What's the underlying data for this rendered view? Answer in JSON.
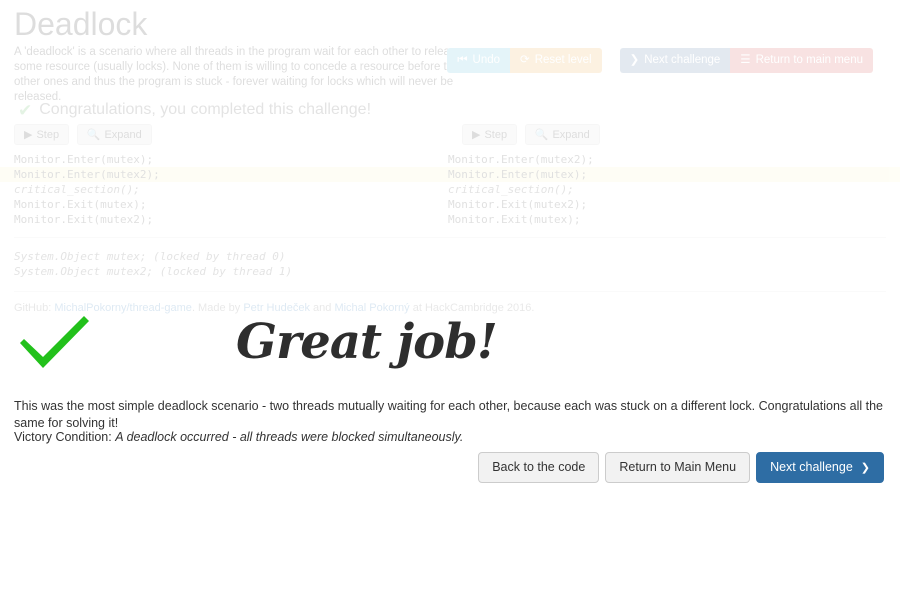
{
  "header": {
    "title": "Deadlock",
    "description": "A 'deadlock' is a scenario where all threads in the program wait for each other to release some resource (usually locks). None of them is willing to concede a resource before the other ones and thus the program is stuck - forever waiting for locks which will never be released."
  },
  "top_buttons": {
    "undo": "Undo",
    "reset": "Reset level",
    "next_challenge": "Next challenge",
    "return_menu": "Return to main menu",
    "undo_icon": "step-backward-icon",
    "reset_icon": "refresh-icon",
    "next_icon": "chevron-right-icon",
    "menu_icon": "hamburger-menu-icon"
  },
  "status": {
    "check_icon": "check-mark-icon",
    "message": "Congratulations, you completed this challenge!"
  },
  "thread_controls": {
    "step": "Step",
    "expand": "Expand",
    "step_icon": "play-icon",
    "expand_icon": "magnifier-icon"
  },
  "code": {
    "rows": [
      {
        "left": "Monitor.Enter(mutex);",
        "right": "Monitor.Enter(mutex2);",
        "highlight": false,
        "italic": false
      },
      {
        "left": "Monitor.Enter(mutex2);",
        "right": "Monitor.Enter(mutex);",
        "highlight": true,
        "italic": false
      },
      {
        "left": "critical_section();",
        "right": "critical_section();",
        "highlight": false,
        "italic": true
      },
      {
        "left": "Monitor.Exit(mutex);",
        "right": "Monitor.Exit(mutex2);",
        "highlight": false,
        "italic": false
      },
      {
        "left": "Monitor.Exit(mutex2);",
        "right": "Monitor.Exit(mutex);",
        "highlight": false,
        "italic": false
      }
    ]
  },
  "locks": {
    "lines": [
      "System.Object mutex; (locked by thread 0)",
      "System.Object mutex2; (locked by thread 1)"
    ]
  },
  "credits": {
    "github_label": "GitHub:",
    "repo": "MichalPokorny/thread-game",
    "made_by": ". Made by",
    "author1": "Petr Hudeček",
    "and": "and",
    "author2": "Michal Pokorný",
    "event": "at HackCambridge 2016."
  },
  "victory": {
    "check_icon": "big-green-check-icon",
    "check_color": "#22c11b",
    "headline": "Great job!",
    "explanation": "This was the most simple deadlock scenario - two threads mutually waiting for each other, because each was stuck on a different lock. Congratulations all the same for solving it!",
    "condition_label": "Victory Condition:",
    "condition_text": "A deadlock occurred - all threads were blocked simultaneously.",
    "buttons": {
      "back_to_code": "Back to the code",
      "return_menu": "Return to Main Menu",
      "next_challenge": "Next challenge",
      "next_icon": "chevron-right-icon"
    }
  },
  "colors": {
    "undo": "#5bc0de",
    "reset": "#f0ad4e",
    "next": "#5a7da6",
    "menu": "#d9534f",
    "primary_button": "#2e6da4",
    "highlight_row": "#fcf8c6",
    "success_green": "#5cb85c"
  }
}
